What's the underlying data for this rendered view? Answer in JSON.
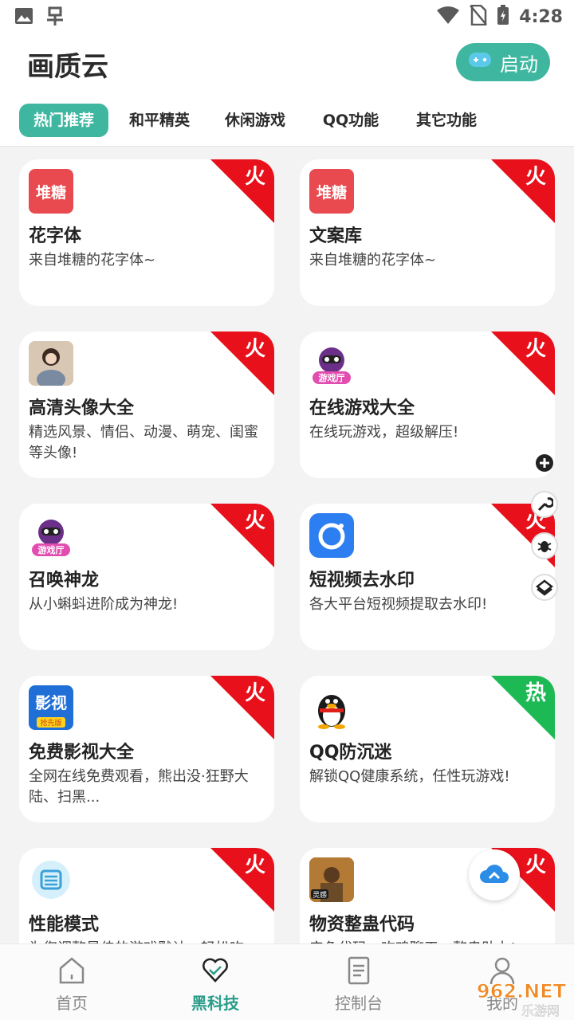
{
  "status_bar": {
    "time": "4:28"
  },
  "header": {
    "title": "画质云",
    "launch_label": "启动"
  },
  "tabs": [
    {
      "label": "热门推荐",
      "active": true
    },
    {
      "label": "和平精英",
      "active": false
    },
    {
      "label": "休闲游戏",
      "active": false
    },
    {
      "label": "QQ功能",
      "active": false
    },
    {
      "label": "其它功能",
      "active": false
    }
  ],
  "cards": [
    {
      "title": "花字体",
      "desc": "来自堆糖的花字体~",
      "icon_text": "堆糖",
      "icon": "duitang-icon",
      "badge": "火",
      "badge_color": "#e8101a"
    },
    {
      "title": "文案库",
      "desc": "来自堆糖的花字体~",
      "icon_text": "堆糖",
      "icon": "duitang-icon",
      "badge": "火",
      "badge_color": "#e8101a"
    },
    {
      "title": "高清头像大全",
      "desc": "精选风景、情侣、动漫、萌宠、闺蜜等头像!",
      "icon": "avatar-photo-icon",
      "badge": "火",
      "badge_color": "#e8101a"
    },
    {
      "title": "在线游戏大全",
      "desc": "在线玩游戏，超级解压!",
      "icon_text": "游戏厅",
      "icon": "game-hall-icon",
      "badge": "火",
      "badge_color": "#e8101a"
    },
    {
      "title": "召唤神龙",
      "desc": "从小蝌蚪进阶成为神龙!",
      "icon_text": "游戏厅",
      "icon": "game-hall-icon",
      "badge": "火",
      "badge_color": "#e8101a"
    },
    {
      "title": "短视频去水印",
      "desc": "各大平台短视频提取去水印!",
      "icon": "camera-icon",
      "badge": "火",
      "badge_color": "#e8101a"
    },
    {
      "title": "免费影视大全",
      "desc": "全网在线免费观看，熊出没·狂野大陆、扫黑...",
      "icon_text": "影视",
      "icon_subtext": "抢先版",
      "icon": "video-icon",
      "badge": "火",
      "badge_color": "#e8101a"
    },
    {
      "title": "QQ防沉迷",
      "desc": "解锁QQ健康系统，任性玩游戏!",
      "icon": "qq-penguin-icon",
      "badge": "热",
      "badge_color": "#1db954"
    },
    {
      "title": "性能模式",
      "desc": "为您调整最佳的游戏默认，轻松吃",
      "icon": "performance-icon",
      "badge": "火",
      "badge_color": "#e8101a"
    },
    {
      "title": "物资整蛊代码",
      "desc": "产色代码，吃鸡聊天，整蛊助力!",
      "icon_text": "灵感",
      "icon": "pubg-icon",
      "badge": "火",
      "badge_color": "#e8101a"
    }
  ],
  "bottom_nav": [
    {
      "label": "首页",
      "icon": "home-icon",
      "active": false
    },
    {
      "label": "黑科技",
      "icon": "heart-icon",
      "active": true
    },
    {
      "label": "控制台",
      "icon": "document-icon",
      "active": false
    },
    {
      "label": "我的",
      "icon": "user-icon",
      "active": false
    }
  ],
  "watermark": {
    "brand": "962.NET",
    "sub": "乐游网"
  },
  "colors": {
    "accent": "#3fb7a0",
    "badge_red": "#e8101a",
    "badge_green": "#1db954"
  }
}
